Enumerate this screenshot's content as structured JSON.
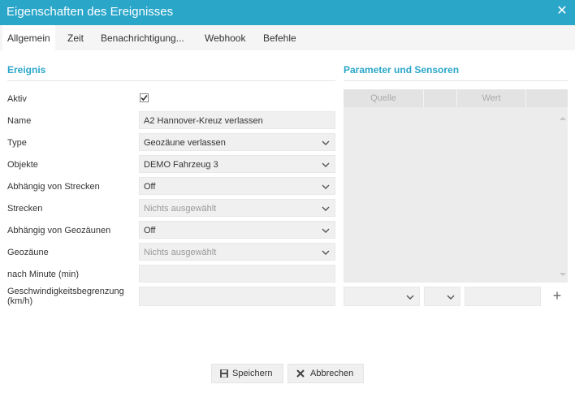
{
  "dialog": {
    "title": "Eigenschaften des Ereignisses",
    "close_icon": "close-icon"
  },
  "tabs": [
    {
      "label": "Allgemein",
      "active": true
    },
    {
      "label": "Zeit"
    },
    {
      "label": "Benachrichtigung..."
    },
    {
      "label": "Webhook"
    },
    {
      "label": "Befehle"
    }
  ],
  "event": {
    "section_title": "Ereignis",
    "fields": {
      "aktiv": {
        "label": "Aktiv",
        "checked": true
      },
      "name": {
        "label": "Name",
        "value": "A2 Hannover-Kreuz verlassen"
      },
      "type": {
        "label": "Type",
        "value": "Geozäune verlassen"
      },
      "objekte": {
        "label": "Objekte",
        "value": "DEMO Fahrzeug 3"
      },
      "abh_strecken": {
        "label": "Abhängig von Strecken",
        "value": "Off"
      },
      "strecken": {
        "label": "Strecken",
        "value": "Nichts ausgewählt"
      },
      "abh_geozaunen": {
        "label": "Abhängig von Geozäunen",
        "value": "Off"
      },
      "geozaune": {
        "label": "Geozäune",
        "value": "Nichts ausgewählt"
      },
      "nach_minute": {
        "label": "nach Minute (min)",
        "value": ""
      },
      "speed_limit": {
        "label_line1": "Geschwindigkeitsbegrenzung",
        "label_line2": "(km/h)",
        "value": ""
      }
    }
  },
  "params": {
    "section_title": "Parameter und Sensoren",
    "columns": [
      "Quelle",
      "",
      "Wert",
      ""
    ],
    "add_icon": "plus-icon"
  },
  "footer": {
    "save_label": "Speichern",
    "cancel_label": "Abbrechen",
    "save_icon": "floppy-disk-icon",
    "cancel_icon": "close-icon"
  },
  "colors": {
    "accent": "#2aa6c9",
    "field_bg": "#f0f0f0",
    "tab_bg": "#f5f5f5"
  }
}
